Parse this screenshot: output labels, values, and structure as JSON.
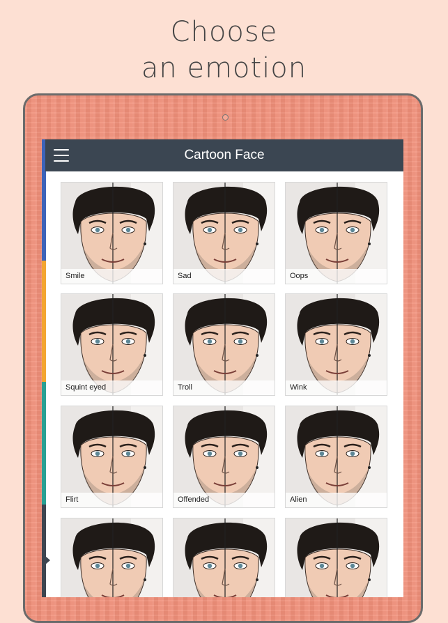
{
  "headline": {
    "line1": "Choose",
    "line2": "an emotion"
  },
  "app": {
    "title": "Cartoon Face",
    "menu_icon": "hamburger-menu-icon"
  },
  "colors": {
    "background": "#fde0d3",
    "tablet_frame": "#f1907a",
    "app_bar": "#3b4652",
    "accent_blue": "#3d63b8",
    "accent_orange": "#f3a531",
    "accent_teal": "#29a093",
    "accent_dark": "#3d4550"
  },
  "emotions": [
    {
      "label": "Smile"
    },
    {
      "label": "Sad"
    },
    {
      "label": "Oops"
    },
    {
      "label": "Squint eyed"
    },
    {
      "label": "Troll"
    },
    {
      "label": "Wink"
    },
    {
      "label": "Flirt"
    },
    {
      "label": "Offended"
    },
    {
      "label": "Alien"
    },
    {
      "label": ""
    },
    {
      "label": ""
    },
    {
      "label": ""
    }
  ]
}
